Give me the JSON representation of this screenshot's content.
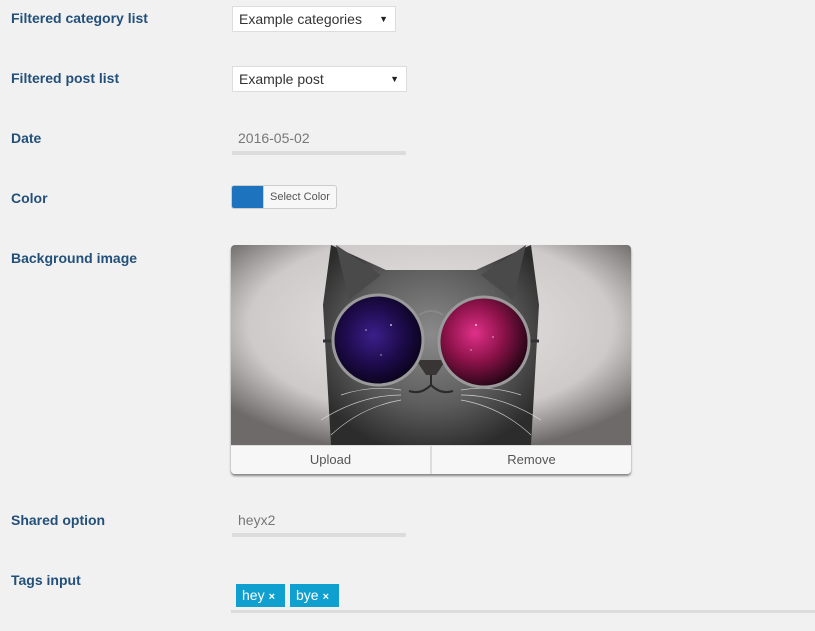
{
  "fields": {
    "category": {
      "label": "Filtered category list",
      "value": "Example categories",
      "arrow": "▼"
    },
    "post": {
      "label": "Filtered post list",
      "value": "Example post",
      "arrow": "▼"
    },
    "date": {
      "label": "Date",
      "value": "2016-05-02"
    },
    "color": {
      "label": "Color",
      "button_label": "Select Color",
      "value": "#1e73be"
    },
    "background": {
      "label": "Background image",
      "image_alt": "Cat wearing round galaxy sunglasses",
      "upload_label": "Upload",
      "remove_label": "Remove"
    },
    "shared": {
      "label": "Shared option",
      "value": "heyx2"
    },
    "tags": {
      "label": "Tags input",
      "items": [
        {
          "text": "hey",
          "remove": "×"
        },
        {
          "text": "bye",
          "remove": "×"
        }
      ]
    }
  }
}
